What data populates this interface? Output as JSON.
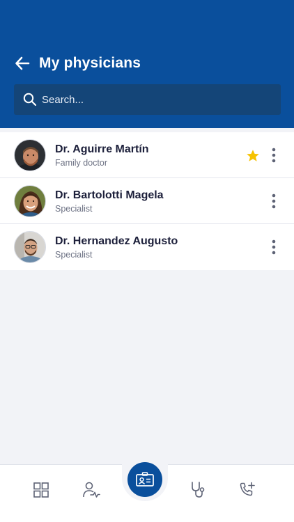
{
  "header": {
    "title": "My physicians",
    "back_icon": "arrow-left-icon"
  },
  "search": {
    "placeholder": "Search...",
    "value": "",
    "icon": "search-icon"
  },
  "physicians": [
    {
      "name": "Dr. Aguirre Martín",
      "role": "Family doctor",
      "favorite": true
    },
    {
      "name": "Dr. Bartolotti Magela",
      "role": "Specialist",
      "favorite": false
    },
    {
      "name": "Dr. Hernandez Augusto",
      "role": "Specialist",
      "favorite": false
    }
  ],
  "bottom_nav": {
    "items": [
      "grid-icon",
      "user-pulse-icon",
      "id-card-icon",
      "stethoscope-icon",
      "phone-plus-icon"
    ],
    "active": "id-card-icon"
  },
  "colors": {
    "brand": "#0a4f9c",
    "search_bg": "#144578",
    "star": "#f6c200",
    "text": "#1c1f3a",
    "muted": "#6d7284",
    "icon_gray": "#5d6275"
  }
}
